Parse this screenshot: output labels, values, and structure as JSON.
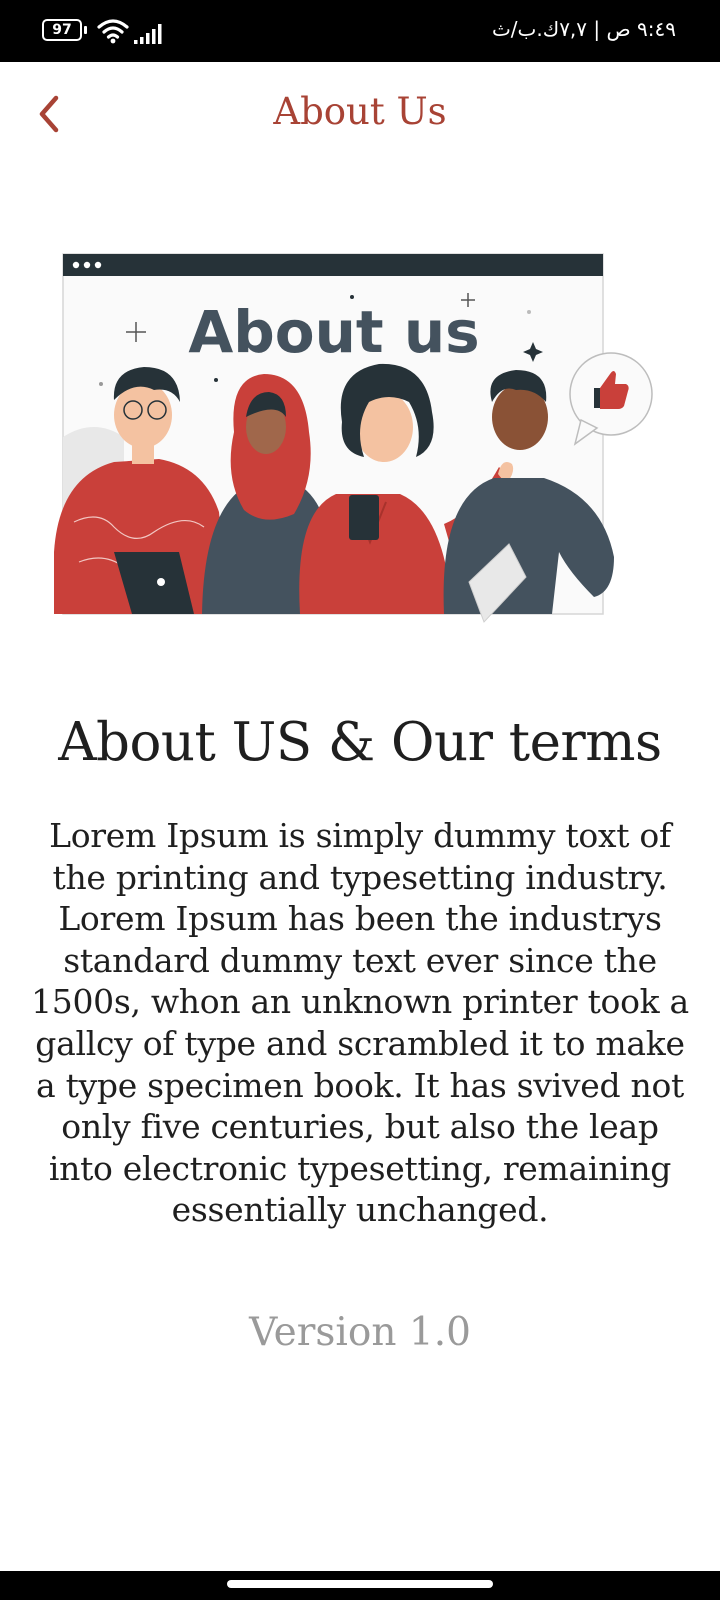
{
  "status_bar": {
    "battery": "97",
    "time": "٩:٤٩ ص | ٧,٧ك.ب/ث",
    "icons": [
      "battery-icon",
      "wifi-icon",
      "signal-icon"
    ]
  },
  "header": {
    "back_icon": "chevron-left-icon",
    "title": "About Us"
  },
  "illustration": {
    "banner_text": "About us"
  },
  "content": {
    "heading": "About US & Our terms",
    "body": "Lorem Ipsum is simply dummy toxt of the printing and typesetting industry. Lorem Ipsum has been the industrys standard dummy text ever since the 1500s, whon an unknown printer took a gallcy of type and scrambled it to make a type specimen book. It has svived not only five centuries, but also the leap into electronic typesetting, remaining essentially unchanged.",
    "version": "Version 1.0"
  },
  "colors": {
    "accent": "#a84335",
    "illustration_red": "#c9403a",
    "illustration_slate": "#44525e",
    "status_bar": "#000000"
  }
}
